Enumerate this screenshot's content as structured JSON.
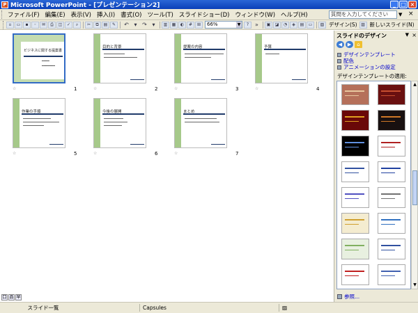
{
  "titlebar": {
    "title": "Microsoft PowerPoint - [プレゼンテーション2]",
    "min": "_",
    "max": "□",
    "close": "×"
  },
  "menubar": {
    "items": [
      "ファイル(F)",
      "編集(E)",
      "表示(V)",
      "挿入(I)",
      "書式(O)",
      "ツール(T)",
      "スライドショー(D)",
      "ウィンドウ(W)",
      "ヘルプ(H)"
    ],
    "help_placeholder": "質問を入力してください",
    "close": "×"
  },
  "toolbar": {
    "zoom": "66%",
    "design_label": "デザイン(S)",
    "new_slide_label": "新しいスライド(N)"
  },
  "slides": [
    {
      "num": "1",
      "title": "ビジネスに関する提案書"
    },
    {
      "num": "2",
      "title": "目的と背景"
    },
    {
      "num": "3",
      "title": "提案の内容"
    },
    {
      "num": "4",
      "title": "予算"
    },
    {
      "num": "5",
      "title": "作業の手順"
    },
    {
      "num": "6",
      "title": "今後の展開"
    },
    {
      "num": "7",
      "title": "まとめ"
    }
  ],
  "view_buttons": [
    "囗",
    "品",
    "早"
  ],
  "taskpane": {
    "title": "スライドのデザイン",
    "links": [
      "デザインテンプレート",
      "配色",
      "アニメーションの設定"
    ],
    "section_label": "デザインテンプレートの適用:",
    "footer_link": "参照...",
    "templates": [
      {
        "bg": "#b5705a",
        "accent": "#e8c8a0"
      },
      {
        "bg": "#6a1010",
        "accent": "#c85030"
      },
      {
        "bg": "#6a0808",
        "accent": "#e0a020"
      },
      {
        "bg": "#181010",
        "accent": "#d07828"
      },
      {
        "bg": "#000000",
        "accent": "#6090e0"
      },
      {
        "bg": "#ffffff",
        "accent": "#b02020"
      },
      {
        "bg": "#ffffff",
        "accent": "#3050a0"
      },
      {
        "bg": "#ffffff",
        "accent": "#2040a0"
      },
      {
        "bg": "#ffffff",
        "accent": "#5050c0"
      },
      {
        "bg": "#ffffff",
        "accent": "#707070"
      },
      {
        "bg": "#f4ecd0",
        "accent": "#d0a030"
      },
      {
        "bg": "#ffffff",
        "accent": "#3070c0"
      },
      {
        "bg": "#e8f0e0",
        "accent": "#80b060"
      },
      {
        "bg": "#ffffff",
        "accent": "#3050a0"
      },
      {
        "bg": "#ffffff",
        "accent": "#c02020"
      },
      {
        "bg": "#ffffff",
        "accent": "#4060b0"
      }
    ]
  },
  "statusbar": {
    "slide_view": "スライド一覧",
    "template_name": "Capsules",
    "language": ""
  }
}
